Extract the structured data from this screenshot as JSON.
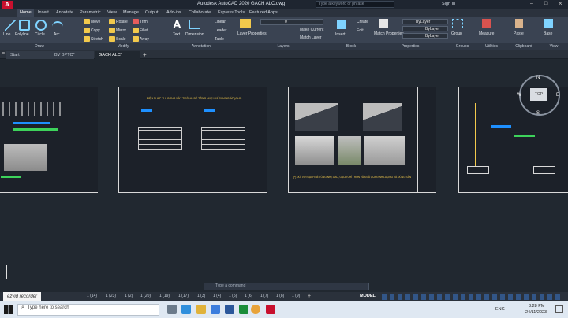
{
  "title": "Autodesk AutoCAD 2020   GACH ALC.dwg",
  "search_placeholder": "Type a keyword or phrase",
  "sign_in": "Sign In",
  "ribbon_tabs": [
    "Home",
    "Insert",
    "Annotate",
    "Parametric",
    "View",
    "Manage",
    "Output",
    "Add-ins",
    "Collaborate",
    "Express Tools",
    "Featured Apps"
  ],
  "draw": {
    "line": "Line",
    "polyline": "Polyline",
    "circle": "Circle",
    "arc": "Arc",
    "panel": "Draw"
  },
  "modify": {
    "move": "Move",
    "rotate": "Rotate",
    "trim": "Trim",
    "copy": "Copy",
    "mirror": "Mirror",
    "fillet": "Fillet",
    "stretch": "Stretch",
    "scale": "Scale",
    "array": "Array",
    "panel": "Modify"
  },
  "annotation": {
    "text": "Text",
    "dimension": "Dimension",
    "linear": "Linear",
    "leader": "Leader",
    "table": "Table",
    "panel": "Annotation"
  },
  "layers": {
    "properties": "Layer Properties",
    "current": "0",
    "make_current": "Make Current",
    "match_layer": "Match Layer",
    "panel": "Layers"
  },
  "block": {
    "insert": "Insert",
    "create": "Create",
    "edit": "Edit",
    "panel": "Block"
  },
  "properties": {
    "match": "Match Properties",
    "bylayer1": "ByLayer",
    "bylayer2": "ByLayer",
    "bylayer3": "ByLayer",
    "panel": "Properties"
  },
  "groups": {
    "group": "Group",
    "panel": "Groups"
  },
  "utilities": {
    "measure": "Measure",
    "panel": "Utilities"
  },
  "clipboard": {
    "paste": "Paste",
    "panel": "Clipboard"
  },
  "view": {
    "base": "Base",
    "panel": "View"
  },
  "file_tabs": [
    "Start",
    "BV BPTC*",
    "GACH ALC*"
  ],
  "viewcube": {
    "top": "TOP",
    "n": "N",
    "s": "S",
    "e": "E",
    "w": "W"
  },
  "sheet2_title": "BIỆN PHÁP THI CÔNG XÂY TƯỜNG BÊ TÔNG NHẸ KHÍ CHƯNG ÁP (ALC)",
  "sheet3_note": "(*) ĐỐI VỚI GẠCH BÊ TÔNG NHẸ AAC, GẠCH CHỈ TRỘN VỮA ĐÃ QUA ĐỊNH LƯỢNG VÀ ĐÓNG SẴN",
  "command_placeholder": "Type a command",
  "layout_tabs": [
    "1 (14)",
    "1 (15)",
    "1 (16)",
    "1 (23)",
    "1 (2)",
    "1 (20)",
    "1 (19)",
    "1 (17)",
    "1 (18)",
    "1 (21)",
    "1 (22)",
    "1 (3)",
    "1 (4)",
    "1 (5)",
    "1 (6)",
    "1 (7)",
    "1 (8)",
    "1 (9)",
    "1 (10)",
    "1 (11)",
    "1 (12)",
    "1 (13)",
    "1"
  ],
  "status": {
    "model": "MODEL",
    "language": "ENG",
    "time": "3:28 PM",
    "date": "24/11/2023"
  },
  "taskbar_search": "Type here to search",
  "watermark": "ezvid recorder"
}
